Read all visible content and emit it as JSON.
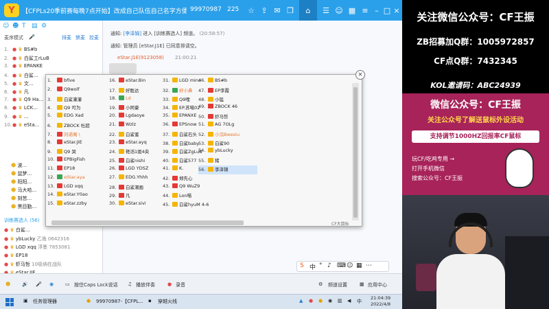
{
  "topbar": {
    "logo": "Y",
    "title": "【CFPLs20季前赛每晚7点开始】改成自己队伍自己名字方便...",
    "room_id": "99970987",
    "online_count": "225",
    "icons": [
      "star-icon",
      "share-icon",
      "message-icon",
      "gift-icon",
      "home-icon",
      "list-icon",
      "person-icon",
      "mail-icon",
      "apps-icon",
      "menu-icon",
      "minimize-icon",
      "maximize-icon",
      "close-icon"
    ]
  },
  "sidebar": {
    "mode_label": "麦序模式",
    "mic_icon": "mic-icon",
    "action_1": "排麦",
    "action_2": "禁麦",
    "action_3": "控麦",
    "queue": [
      {
        "rank": "1.",
        "name": "BS#b"
      },
      {
        "rank": "2.",
        "name": "白鲨工rLuB"
      },
      {
        "rank": "3.",
        "name": "EPANKE"
      },
      {
        "rank": "4.",
        "name": "白鲨..."
      },
      {
        "rank": "5.",
        "name": "文..."
      },
      {
        "rank": "6.",
        "name": "凡"
      },
      {
        "rank": "7.",
        "name": "Q9 Ha..."
      },
      {
        "rank": "8.",
        "name": "LCK..."
      },
      {
        "rank": "9.",
        "name": "..."
      },
      {
        "rank": "10.",
        "name": "eSta..."
      }
    ],
    "tree": [
      {
        "name": "波..."
      },
      {
        "name": "鼠梦..."
      },
      {
        "name": "阳阳..."
      },
      {
        "name": "马大哈..."
      },
      {
        "name": "刻苦..."
      },
      {
        "name": "黑目勤..."
      }
    ],
    "train_label": "训练赛选人 (56)",
    "train_users": [
      {
        "name": "白鲨...",
        "extra": ""
      },
      {
        "name": "ybLucky",
        "extra": "乙逸 0642316"
      },
      {
        "name": "LGD xqq",
        "extra": "浮墨 7853081"
      },
      {
        "name": "EP18",
        "extra": ""
      },
      {
        "name": "虾马哲",
        "extra": "10吸纳在战队"
      },
      {
        "name": "eStar.JIE",
        "extra": ""
      }
    ]
  },
  "chat": {
    "notices": [
      {
        "prefix": "通知:",
        "user": "[李泽锦]",
        "text": "进入 [训练赛选人] 频道。",
        "time": "(20:58:57)"
      },
      {
        "prefix": "通知:",
        "user": "管理员",
        "text": "[eStar.J1E] 已同意排请空。",
        "time": ""
      }
    ],
    "sender": "eStar.J1E(9123058)",
    "send_time": "21:00:21"
  },
  "popup": {
    "status": "CF大鼠标",
    "columns": [
      [
        {
          "n": "1.",
          "name": "bfive",
          "ico": "r"
        },
        {
          "n": "2.",
          "name": "Q9wolf",
          "ico": "r"
        },
        {
          "n": "3.",
          "name": "白鲨灌灌",
          "ico": "c"
        },
        {
          "n": "4.",
          "name": "Q9 可为",
          "ico": "c"
        },
        {
          "n": "5.",
          "name": "EDG Xad",
          "ico": "c"
        },
        {
          "n": "6.",
          "name": "ZBOCK 杜超",
          "ico": "c"
        },
        {
          "n": "7.",
          "name": "刘诺阁 \\",
          "ico": "r",
          "hl": true
        },
        {
          "n": "8.",
          "name": "eStar.JIE",
          "ico": "r"
        },
        {
          "n": "9.",
          "name": "Q9 哭",
          "ico": "c"
        },
        {
          "n": "10.",
          "name": "EPBigFish",
          "ico": "r"
        },
        {
          "n": "11.",
          "name": "EP18",
          "ico": "r"
        },
        {
          "n": "12.",
          "name": "eStar.aya",
          "ico": "g",
          "hl": true
        },
        {
          "n": "13.",
          "name": "LGD xqq",
          "ico": "r"
        },
        {
          "n": "14.",
          "name": "eStar.Y0ao",
          "ico": "c"
        },
        {
          "n": "15.",
          "name": "eStar.zzby",
          "ico": "c"
        }
      ],
      [
        {
          "n": "16.",
          "name": "eStar.Bin",
          "ico": "r"
        },
        {
          "n": "17.",
          "name": "好胜达",
          "ico": "c"
        },
        {
          "n": "18.",
          "name": "Ld",
          "ico": "g",
          "hl": true
        },
        {
          "n": "19.",
          "name": "小阿豪",
          "ico": "r"
        },
        {
          "n": "20.",
          "name": "Lgdaoye",
          "ico": "r"
        },
        {
          "n": "21.",
          "name": "Wzlz",
          "ico": "r"
        },
        {
          "n": "22.",
          "name": "白鲨蜜",
          "ico": "c"
        },
        {
          "n": "23.",
          "name": "eStar.ayq",
          "ico": "r"
        },
        {
          "n": "24.",
          "name": "艳滔1姐4央",
          "ico": "c"
        },
        {
          "n": "25.",
          "name": "白鲨nishi",
          "ico": "r"
        },
        {
          "n": "26.",
          "name": "LGD YDSZ",
          "ico": "r"
        },
        {
          "n": "27.",
          "name": "EDG.Yhhh",
          "ico": "c"
        },
        {
          "n": "28.",
          "name": "白鲨潮画",
          "ico": "r"
        },
        {
          "n": "29.",
          "name": "凡",
          "ico": "r"
        },
        {
          "n": "30.",
          "name": "eStar.sivi",
          "ico": "c"
        }
      ],
      [
        {
          "n": "31.",
          "name": "LGD mino",
          "ico": "c"
        },
        {
          "n": "32.",
          "name": "好小鼻",
          "ico": "g",
          "hl": true
        },
        {
          "n": "33.",
          "name": "Q9哩",
          "ico": "c"
        },
        {
          "n": "34.",
          "name": "EP.苏喵02",
          "ico": "c"
        },
        {
          "n": "35.",
          "name": "EPANXE",
          "ico": "c"
        },
        {
          "n": "36.",
          "name": "EPSnow",
          "ico": "r"
        },
        {
          "n": "37.",
          "name": "白鲨石头",
          "ico": "c"
        },
        {
          "n": "38.",
          "name": "白鲨baby",
          "ico": "c"
        },
        {
          "n": "39.",
          "name": "白鲨ZgLuB",
          "ico": "c"
        },
        {
          "n": "40.",
          "name": "白鲨577",
          "ico": "c"
        },
        {
          "n": "41.",
          "name": "K.",
          "ico": "c"
        },
        {
          "n": "42.",
          "name": "郑先心",
          "ico": "r"
        },
        {
          "n": "43.",
          "name": "Q9 WuZ9",
          "ico": "r"
        },
        {
          "n": "44.",
          "name": "Lon喵",
          "ico": "c"
        },
        {
          "n": "45.",
          "name": "白鲨hyuM 4-6",
          "ico": "c"
        }
      ],
      [
        {
          "n": "46.",
          "name": "BS#b",
          "ico": "c"
        },
        {
          "n": "47.",
          "name": "EP李霞",
          "ico": "r"
        },
        {
          "n": "48.",
          "name": "小猛",
          "ico": "c"
        },
        {
          "n": "49.",
          "name": "ZBOCK 46",
          "ico": "r"
        },
        {
          "n": "50.",
          "name": "虾马哲",
          "ico": "r"
        },
        {
          "n": "51.",
          "name": "AG 7OLg",
          "ico": "c"
        },
        {
          "n": "52.",
          "name": "小浣Bwesiu",
          "ico": "c",
          "hl": true
        },
        {
          "n": "53.",
          "name": "白鲨90",
          "ico": "c"
        },
        {
          "n": "54.",
          "name": "ybLucky",
          "ico": "c"
        },
        {
          "n": "55.",
          "name": "猪",
          "ico": "c"
        },
        {
          "n": "56.",
          "name": "李泽锦",
          "ico": "c",
          "blue": true
        }
      ]
    ]
  },
  "bottombar": {
    "ptt": "按住Caps Lock说话",
    "play_accompaniment": "播放伴奏",
    "record": "录音",
    "channel_settings": "频道设置",
    "app_center": "应用中心"
  },
  "promo": {
    "line1": "关注微信公众号：CF王振",
    "line2": "ZB招募加Q群：1005972857",
    "line3": "CF点Q群：7432345",
    "line4": "KOL邀请码：ABC24939",
    "ad_title": "微信公众号：CF王振",
    "ad_sub": "关注公众号了解送鼠标外设活动",
    "ad_box": "支持调节1000HZ回报率CF鼠标",
    "ad_l1": "玩CF/吃鸡专用 →",
    "ad_l2": "打开手机微信",
    "ad_l3": "搜索公众号：CF王振",
    "colors": {
      "accent": "#ffd84a",
      "ad_bg": "#a8235a"
    }
  },
  "taskbar": {
    "task_manager": "任务管理器",
    "yy_window": "99970987-【CFPL...",
    "game": "穿越火线",
    "time": "21:04:39",
    "date": "2022/4/8"
  }
}
